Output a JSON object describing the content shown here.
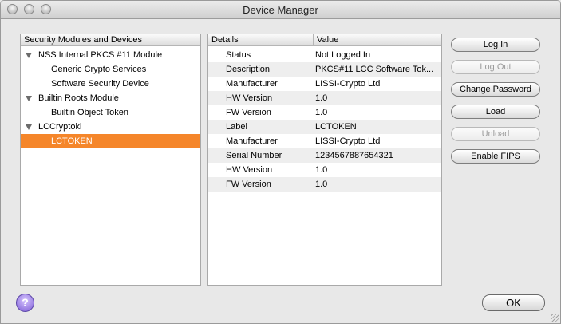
{
  "window": {
    "title": "Device Manager"
  },
  "tree": {
    "header": "Security Modules and Devices",
    "items": [
      {
        "label": "NSS Internal PKCS #11 Module",
        "level": 0,
        "expanded": true
      },
      {
        "label": "Generic Crypto Services",
        "level": 1
      },
      {
        "label": "Software Security Device",
        "level": 1
      },
      {
        "label": "Builtin Roots Module",
        "level": 0,
        "expanded": true
      },
      {
        "label": "Builtin Object Token",
        "level": 1
      },
      {
        "label": "LCCryptoki",
        "level": 0,
        "expanded": true
      },
      {
        "label": "LCTOKEN",
        "level": 1,
        "selected": true
      }
    ]
  },
  "details": {
    "col_details": "Details",
    "col_value": "Value",
    "rows": [
      {
        "key": "Status",
        "value": "Not Logged In"
      },
      {
        "key": "Description",
        "value": "PKCS#11 LCC Software Tok..."
      },
      {
        "key": "Manufacturer",
        "value": "LISSI-Crypto Ltd"
      },
      {
        "key": "HW Version",
        "value": "1.0"
      },
      {
        "key": "FW Version",
        "value": "1.0"
      },
      {
        "key": "Label",
        "value": "LCTOKEN"
      },
      {
        "key": "Manufacturer",
        "value": "LISSI-Crypto Ltd"
      },
      {
        "key": "Serial Number",
        "value": "1234567887654321"
      },
      {
        "key": "HW Version",
        "value": "1.0"
      },
      {
        "key": "FW Version",
        "value": "1.0"
      }
    ]
  },
  "buttons": {
    "login": "Log In",
    "logout": "Log Out",
    "change_password": "Change Password",
    "load": "Load",
    "unload": "Unload",
    "enable_fips": "Enable FIPS",
    "ok": "OK",
    "help": "?"
  },
  "colors": {
    "selection": "#f5862a"
  },
  "icons": {
    "help": "help-icon",
    "expand": "disclosure-triangle-icon"
  }
}
